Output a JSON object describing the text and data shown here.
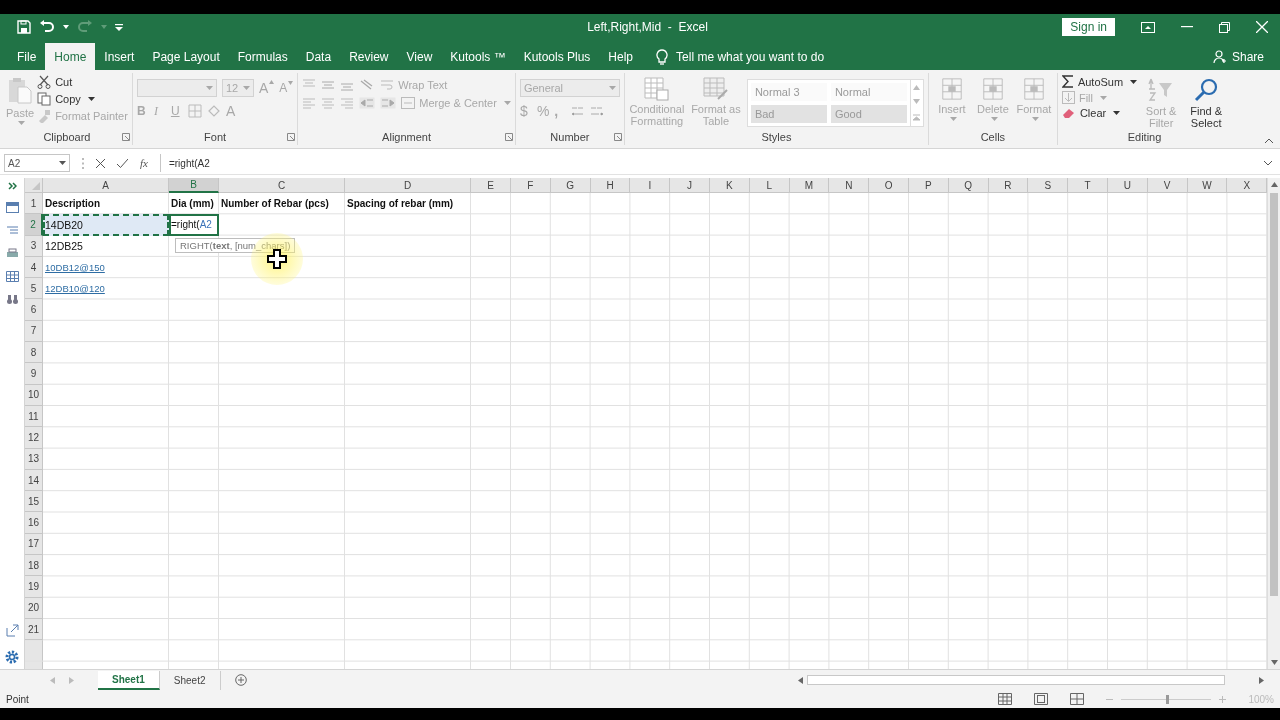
{
  "window": {
    "title": "Left,Right,Mid  -  Excel",
    "sign_in": "Sign in"
  },
  "tabs": [
    {
      "label": "File",
      "selected": false
    },
    {
      "label": "Home",
      "selected": true
    },
    {
      "label": "Insert",
      "selected": false
    },
    {
      "label": "Page Layout",
      "selected": false
    },
    {
      "label": "Formulas",
      "selected": false
    },
    {
      "label": "Data",
      "selected": false
    },
    {
      "label": "Review",
      "selected": false
    },
    {
      "label": "View",
      "selected": false
    },
    {
      "label": "Kutools ™",
      "selected": false
    },
    {
      "label": "Kutools Plus",
      "selected": false
    },
    {
      "label": "Help",
      "selected": false
    }
  ],
  "tell_me": "Tell me what you want to do",
  "share": "Share",
  "ribbon": {
    "clipboard": {
      "label": "Clipboard",
      "paste": {
        "label": "Paste",
        "disabled": true
      },
      "cut": {
        "label": "Cut",
        "disabled": false
      },
      "copy": {
        "label": "Copy",
        "disabled": false
      },
      "format_painter": {
        "label": "Format Painter",
        "disabled": true
      }
    },
    "font": {
      "label": "Font",
      "disabled": true,
      "font_size": "12",
      "grow": "A",
      "shrink": "A",
      "bold": "B",
      "italic": "I",
      "underline": "U",
      "font_color": "A"
    },
    "alignment": {
      "label": "Alignment",
      "disabled": true,
      "wrap_text": "Wrap Text",
      "merge_center": "Merge & Center"
    },
    "number": {
      "label": "Number",
      "disabled": true,
      "format": "General",
      "currency": "$",
      "percent": "%",
      "comma": ","
    },
    "styles": {
      "label": "Styles",
      "disabled": true,
      "conditional_formatting": "Conditional Formatting",
      "format_as_table": "Format as Table",
      "gallery": [
        {
          "label": "Normal 3",
          "kind": "plain"
        },
        {
          "label": "Normal",
          "kind": "plain"
        },
        {
          "label": "Bad",
          "kind": "shaded"
        },
        {
          "label": "Good",
          "kind": "shaded"
        }
      ]
    },
    "cells": {
      "label": "Cells",
      "disabled": true,
      "buttons": [
        "Insert",
        "Delete",
        "Format"
      ]
    },
    "editing": {
      "label": "Editing",
      "autosum": {
        "label": "AutoSum",
        "disabled": false
      },
      "fill": {
        "label": "Fill",
        "disabled": true
      },
      "clear": {
        "label": "Clear",
        "disabled": false
      },
      "sort_filter": {
        "label": "Sort & Filter",
        "disabled": true
      },
      "find_select": {
        "label": "Find & Select",
        "disabled": false
      }
    }
  },
  "formula_bar": {
    "name_box": "A2",
    "fx": "fx",
    "formula": "=right(A2"
  },
  "columns": [
    {
      "label": "A",
      "selected": false
    },
    {
      "label": "B",
      "selected": true
    },
    {
      "label": "C",
      "selected": false
    },
    {
      "label": "D",
      "selected": false
    },
    {
      "label": "E",
      "selected": false
    },
    {
      "label": "F",
      "selected": false
    },
    {
      "label": "G",
      "selected": false
    },
    {
      "label": "H",
      "selected": false
    },
    {
      "label": "I",
      "selected": false
    },
    {
      "label": "J",
      "selected": false
    },
    {
      "label": "K",
      "selected": false
    },
    {
      "label": "L",
      "selected": false
    },
    {
      "label": "M",
      "selected": false
    },
    {
      "label": "N",
      "selected": false
    },
    {
      "label": "O",
      "selected": false
    },
    {
      "label": "P",
      "selected": false
    },
    {
      "label": "Q",
      "selected": false
    },
    {
      "label": "R",
      "selected": false
    },
    {
      "label": "S",
      "selected": false
    },
    {
      "label": "T",
      "selected": false
    },
    {
      "label": "U",
      "selected": false
    },
    {
      "label": "V",
      "selected": false
    },
    {
      "label": "W",
      "selected": false
    },
    {
      "label": "X",
      "selected": false
    }
  ],
  "rows": [
    {
      "number": "1",
      "selected": false,
      "cells": [
        {
          "kind": "bold",
          "text": "Description"
        },
        {
          "kind": "bold",
          "text": "Dia (mm)"
        },
        {
          "kind": "bold",
          "text": "Number of Rebar (pcs)"
        },
        {
          "kind": "bold",
          "text": "Spacing of rebar (mm)"
        }
      ]
    },
    {
      "number": "2",
      "selected": true,
      "cells": [
        {
          "kind": "plain",
          "text": "14DB20",
          "marquee": true
        },
        {
          "kind": "editing",
          "text": "=right(",
          "ref": "A2"
        }
      ]
    },
    {
      "number": "3",
      "selected": false,
      "cells": [
        {
          "kind": "plain",
          "text": "12DB25"
        }
      ]
    },
    {
      "number": "4",
      "selected": false,
      "cells": [
        {
          "kind": "link",
          "text": "10DB12@150"
        }
      ]
    },
    {
      "number": "5",
      "selected": false,
      "cells": [
        {
          "kind": "link",
          "text": "12DB10@120"
        }
      ]
    },
    {
      "number": "6",
      "selected": false,
      "cells": []
    },
    {
      "number": "7",
      "selected": false,
      "cells": []
    },
    {
      "number": "8",
      "selected": false,
      "cells": []
    },
    {
      "number": "9",
      "selected": false,
      "cells": []
    },
    {
      "number": "10",
      "selected": false,
      "cells": []
    },
    {
      "number": "11",
      "selected": false,
      "cells": []
    },
    {
      "number": "12",
      "selected": false,
      "cells": []
    },
    {
      "number": "13",
      "selected": false,
      "cells": []
    },
    {
      "number": "14",
      "selected": false,
      "cells": []
    },
    {
      "number": "15",
      "selected": false,
      "cells": []
    },
    {
      "number": "16",
      "selected": false,
      "cells": []
    },
    {
      "number": "17",
      "selected": false,
      "cells": []
    },
    {
      "number": "18",
      "selected": false,
      "cells": []
    },
    {
      "number": "19",
      "selected": false,
      "cells": []
    },
    {
      "number": "20",
      "selected": false,
      "cells": []
    },
    {
      "number": "21",
      "selected": false,
      "cells": []
    }
  ],
  "tooltip": "RIGHT(**text**, [num_chars])",
  "sheet_tabs": [
    {
      "label": "Sheet1",
      "selected": true
    },
    {
      "label": "Sheet2",
      "selected": false
    }
  ],
  "status_bar": {
    "mode": "Point",
    "zoom": {
      "level": 0.5,
      "reading": "100%"
    }
  }
}
